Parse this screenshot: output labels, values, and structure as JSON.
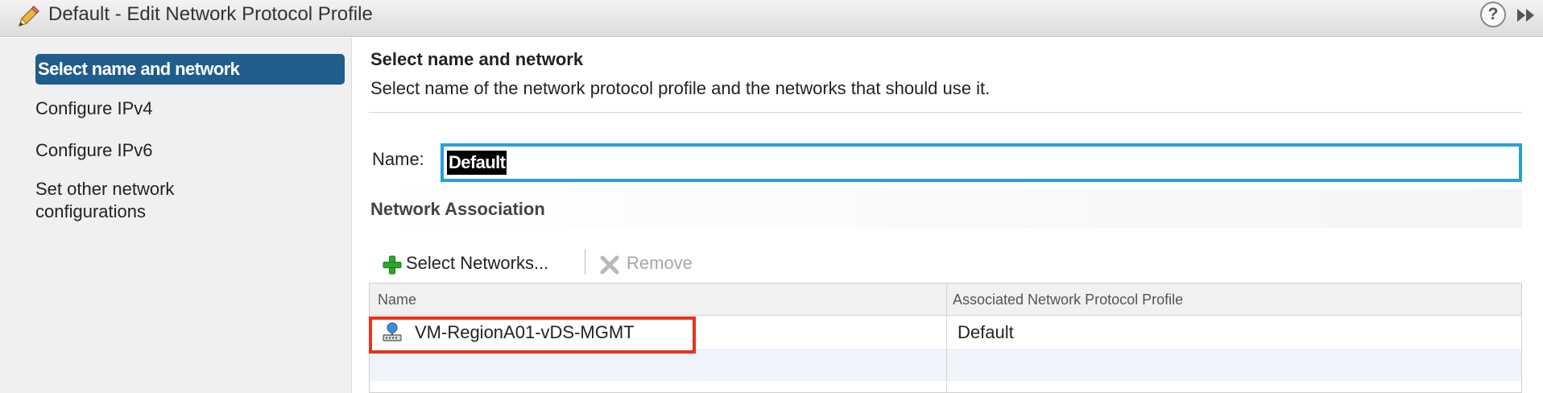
{
  "dialog": {
    "title": "Default - Edit Network Protocol Profile",
    "help_glyph": "?"
  },
  "sidebar": {
    "items": [
      {
        "label": "Select name and network",
        "active": true
      },
      {
        "label": "Configure IPv4",
        "active": false
      },
      {
        "label": "Configure IPv6",
        "active": false
      },
      {
        "label": "Set other network configurations",
        "active": false
      }
    ]
  },
  "main": {
    "step_title": "Select name and network",
    "step_description": "Select name of the network protocol profile and the networks that should use it.",
    "name_label": "Name:",
    "name_value": "Default",
    "section_title": "Network Association",
    "toolbar": {
      "select_networks_label": "Select Networks...",
      "remove_label": "Remove",
      "remove_enabled": false
    },
    "grid": {
      "columns": [
        "Name",
        "Associated Network Protocol Profile"
      ],
      "rows": [
        {
          "name": "VM-RegionA01-vDS-MGMT",
          "profile": "Default",
          "icon": "distributed-port-group-icon",
          "highlighted": true
        }
      ]
    }
  },
  "colors": {
    "active_nav": "#1f5d8c",
    "input_focus": "#2a9fd6",
    "highlight": "#e8321e",
    "add_icon": "#2aa82a"
  }
}
